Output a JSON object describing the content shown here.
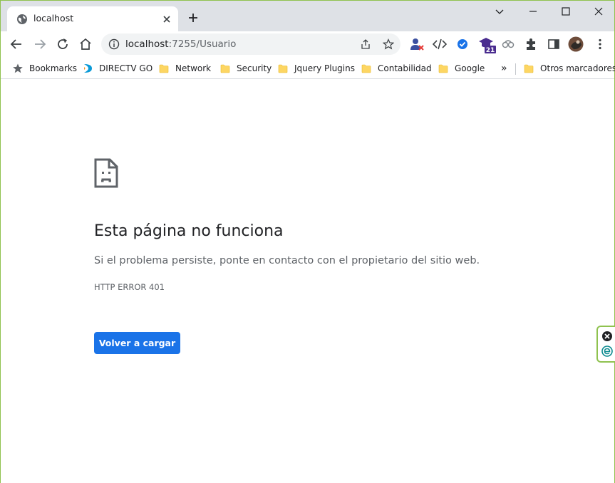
{
  "tab": {
    "title": "localhost",
    "favicon": "globe-icon"
  },
  "toolbar": {
    "url_host": "localhost",
    "url_path": ":7255/Usuario"
  },
  "bookmarks": {
    "items": [
      {
        "label": "Bookmarks",
        "icon": "star-icon"
      },
      {
        "label": "DIRECTV GO",
        "icon": "directv-icon"
      },
      {
        "label": "Network",
        "icon": "folder-icon"
      },
      {
        "label": "Security",
        "icon": "folder-icon"
      },
      {
        "label": "Jquery Plugins",
        "icon": "folder-icon"
      },
      {
        "label": "Contabilidad",
        "icon": "folder-icon"
      },
      {
        "label": "Google",
        "icon": "folder-icon"
      }
    ],
    "overflow": "»",
    "other": "Otros marcadores"
  },
  "extensions": {
    "badge_count": "21"
  },
  "error": {
    "title": "Esta página no funciona",
    "description": "Si el problema persiste, ponte en contacto con el propietario del sitio web.",
    "code": "HTTP ERROR 401",
    "reload_label": "Volver a cargar"
  },
  "colors": {
    "accent": "#1a73e8",
    "tabstrip": "#dee1e6",
    "window_border": "#8fc24f"
  }
}
